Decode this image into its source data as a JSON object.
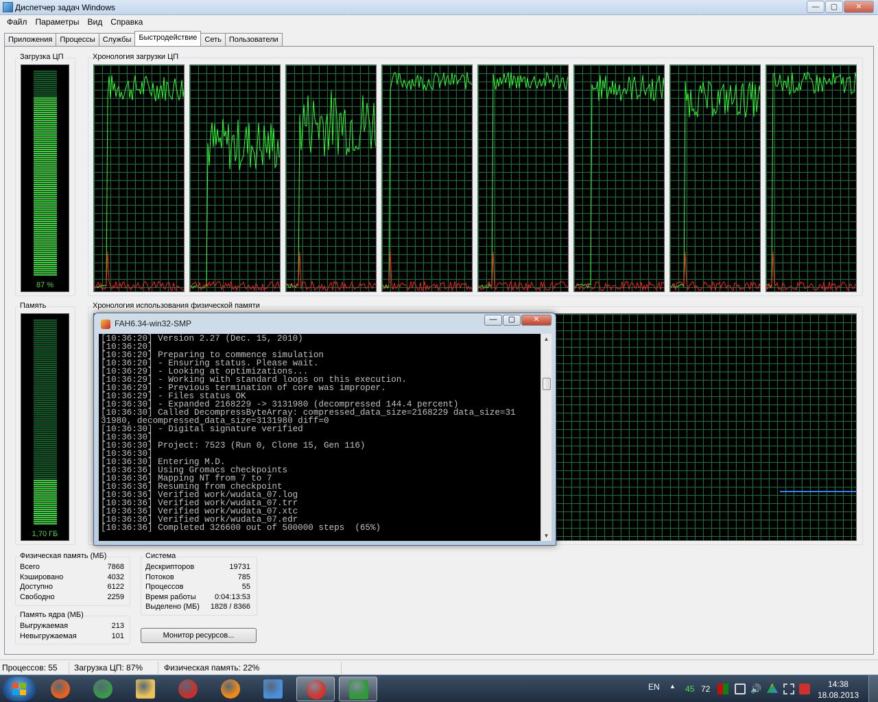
{
  "window": {
    "title": "Диспетчер задач Windows",
    "minimize": "—",
    "maximize": "▢",
    "close": "✕"
  },
  "menu": [
    "Файл",
    "Параметры",
    "Вид",
    "Справка"
  ],
  "tabs": [
    "Приложения",
    "Процессы",
    "Службы",
    "Быстродействие",
    "Сеть",
    "Пользователи"
  ],
  "active_tab": "Быстродействие",
  "cpu": {
    "usage_label": "Загрузка ЦП",
    "usage_value": "87 %",
    "usage_fraction": 0.87,
    "history_label": "Хронология загрузки ЦП",
    "core_count": 8,
    "accent_color": "#33ff33",
    "kernel_color": "#ff2020"
  },
  "memory": {
    "label": "Память",
    "value": "1,70 ГБ",
    "usage_fraction": 0.22,
    "history_label": "Хронология использования физической памяти",
    "line_color": "#2f7fff"
  },
  "physical_memory": {
    "title": "Физическая память (МБ)",
    "rows": [
      {
        "label": "Всего",
        "value": "7868"
      },
      {
        "label": "Кэшировано",
        "value": "4032"
      },
      {
        "label": "Доступно",
        "value": "6122"
      },
      {
        "label": "Свободно",
        "value": "2259"
      }
    ]
  },
  "kernel_memory": {
    "title": "Память ядра (МБ)",
    "rows": [
      {
        "label": "Выгружаемая",
        "value": "213"
      },
      {
        "label": "Невыгружаемая",
        "value": "101"
      }
    ]
  },
  "system": {
    "title": "Система",
    "rows": [
      {
        "label": "Дескрипторов",
        "value": "19731"
      },
      {
        "label": "Потоков",
        "value": "785"
      },
      {
        "label": "Процессов",
        "value": "55"
      },
      {
        "label": "Время работы",
        "value": "0:04:13:53"
      },
      {
        "label": "Выделено (МБ)",
        "value": "1828 / 8366"
      }
    ]
  },
  "resource_monitor_button": "Монитор ресурсов...",
  "statusbar": {
    "processes": "Процессов: 55",
    "cpu": "Загрузка ЦП: 87%",
    "memory": "Физическая память: 22%"
  },
  "console": {
    "title": "FAH6.34-win32-SMP",
    "lines": [
      "[10:36:20] Version 2.27 (Dec. 15, 2010)",
      "[10:36:20]",
      "[10:36:20] Preparing to commence simulation",
      "[10:36:20] - Ensuring status. Please wait.",
      "[10:36:29] - Looking at optimizations...",
      "[10:36:29] - Working with standard loops on this execution.",
      "[10:36:29] - Previous termination of core was improper.",
      "[10:36:29] - Files status OK",
      "[10:36:30] - Expanded 2168229 -> 3131980 (decompressed 144.4 percent)",
      "[10:36:30] Called DecompressByteArray: compressed_data_size=2168229 data_size=31",
      "31980, decompressed_data_size=3131980 diff=0",
      "[10:36:30] - Digital signature verified",
      "[10:36:30]",
      "[10:36:30] Project: 7523 (Run 0, Clone 15, Gen 116)",
      "[10:36:30]",
      "[10:36:30] Entering M.D.",
      "[10:36:36] Using Gromacs checkpoints",
      "[10:36:36] Mapping NT from 7 to 7",
      "[10:36:36] Resuming from checkpoint",
      "[10:36:36] Verified work/wudata_07.log",
      "[10:36:36] Verified work/wudata_07.trr",
      "[10:36:36] Verified work/wudata_07.xtc",
      "[10:36:36] Verified work/wudata_07.edr",
      "[10:36:36] Completed 326600 out of 500000 steps  (65%)"
    ]
  },
  "taskbar": {
    "items": [
      {
        "name": "firefox-icon",
        "color": "#e8621d"
      },
      {
        "name": "chrome-icon",
        "color": "#3a9b48"
      },
      {
        "name": "folder-icon",
        "color": "#e9c25a"
      },
      {
        "name": "calendar-321-icon",
        "color": "#c9302c"
      },
      {
        "name": "media-player-icon",
        "color": "#f08a18"
      },
      {
        "name": "control-panel-icon",
        "color": "#4a90d9"
      },
      {
        "name": "fah-icon",
        "color": "#d8332b"
      },
      {
        "name": "task-manager-icon",
        "color": "#2f9a3a"
      }
    ],
    "language": "EN",
    "tray_num1": "45",
    "tray_num2": "72",
    "time": "14:38",
    "date": "18.08.2013"
  }
}
